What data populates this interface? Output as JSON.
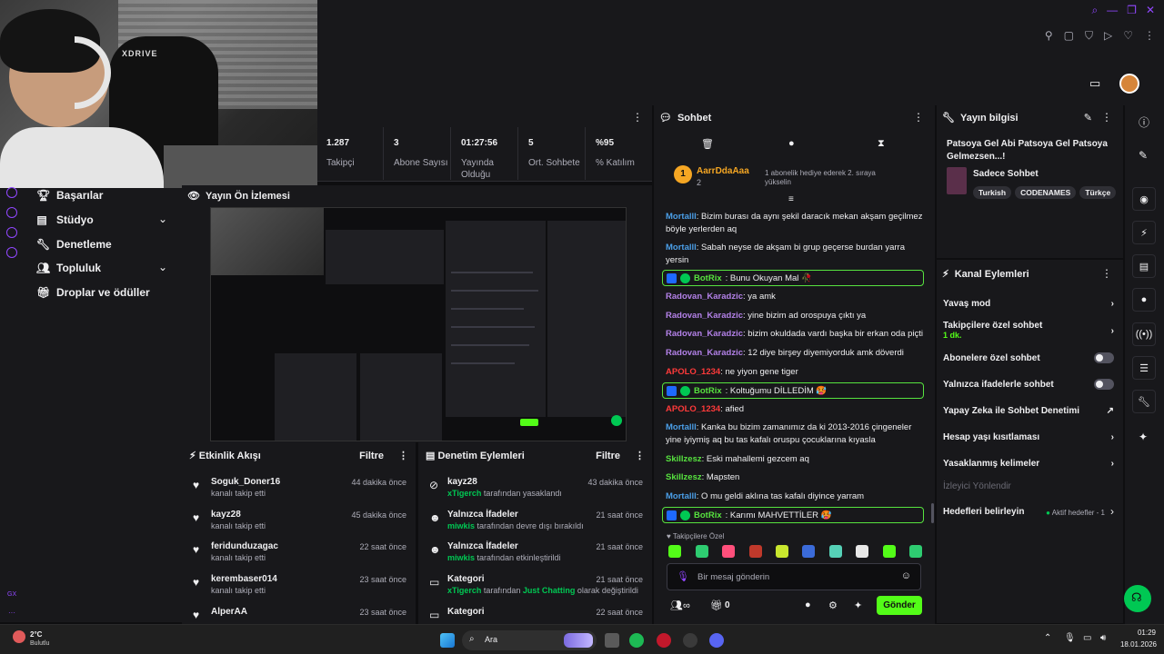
{
  "webcam": {
    "chair_logo": "XDRIVE"
  },
  "stats": [
    {
      "value": "1.287",
      "label": "Takipçi"
    },
    {
      "value": "3",
      "label": "Abone Sayısı"
    },
    {
      "value": "01:27:56",
      "label": "Yayında Olduğu"
    },
    {
      "value": "5",
      "label": "Ort. Sohbete"
    },
    {
      "value": "%95",
      "label": "% Katılım"
    }
  ],
  "nav": {
    "items": [
      {
        "label": "Başarılar",
        "icon": "trophy-icon"
      },
      {
        "label": "Stüdyo",
        "icon": "studio-icon"
      },
      {
        "label": "Denetleme",
        "icon": "wrench-icon"
      },
      {
        "label": "Topluluk",
        "icon": "community-icon"
      },
      {
        "label": "Droplar ve ödüller",
        "icon": "gift-icon"
      }
    ]
  },
  "preview": {
    "title": "Yayın Ön İzlemesi"
  },
  "activity": {
    "title": "Etkinlik Akışı",
    "filter": "Filtre",
    "items": [
      {
        "name": "Soguk_Doner16",
        "sub": "kanalı takip etti",
        "time": "44 dakika önce"
      },
      {
        "name": "kayz28",
        "sub": "kanalı takip etti",
        "time": "45 dakika önce"
      },
      {
        "name": "feridunduzagac",
        "sub": "kanalı takip etti",
        "time": "22 saat önce"
      },
      {
        "name": "kerembaser014",
        "sub": "kanalı takip etti",
        "time": "23 saat önce"
      },
      {
        "name": "AlperAA",
        "sub": "",
        "time": "23 saat önce"
      }
    ]
  },
  "moderation": {
    "title": "Denetim Eylemleri",
    "filter": "Filtre",
    "items": [
      {
        "name": "kayz28",
        "actor": "xTigerch",
        "sub": " tarafından yasaklandı",
        "extra": "",
        "sub2": "",
        "time": "43 dakika önce"
      },
      {
        "name": "Yalnızca İfadeler",
        "actor": "miwkis",
        "sub": " tarafından devre dışı bırakıldı",
        "extra": "",
        "sub2": "",
        "time": "21 saat önce"
      },
      {
        "name": "Yalnızca İfadeler",
        "actor": "miwkis",
        "sub": " tarafından etkinleştirildi",
        "extra": "",
        "sub2": "",
        "time": "21 saat önce"
      },
      {
        "name": "Kategori",
        "actor": "xTigerch",
        "sub": " tarafından ",
        "extra": "Just Chatting",
        "sub2": " olarak değiştirildi",
        "time": "21 saat önce"
      },
      {
        "name": "Kategori",
        "actor": "",
        "sub": "",
        "extra": "",
        "sub2": "",
        "time": "22 saat önce"
      }
    ]
  },
  "chat": {
    "title": "Sohbet",
    "pinned_user": "AarrDdaAaa",
    "pinned_count": "2",
    "pinned_text": "1 abonelik hediye ederek 2. sıraya yükselin",
    "messages": [
      {
        "user": "Mortalll",
        "cls": "u-mortal",
        "text": ": Bizim burası da aynı şekil daracık mekan akşam geçilmez böyle yerlerden aq"
      },
      {
        "user": "Mortalll",
        "cls": "u-mortal",
        "text": ": Sabah neyse de akşam bi grup geçerse burdan yarra yersin"
      },
      {
        "user": "BotRix",
        "cls": "u-bot",
        "text": ": Bunu Okuyan Mal 🥀",
        "bot": true
      },
      {
        "user": "Radovan_Karadzic",
        "cls": "u-radovan",
        "text": ": ya amk"
      },
      {
        "user": "Radovan_Karadzic",
        "cls": "u-radovan",
        "text": ": yine bizim ad orospuya çıktı ya"
      },
      {
        "user": "Radovan_Karadzic",
        "cls": "u-radovan",
        "text": ": bizim okuldada vardı başka bir erkan oda piçti"
      },
      {
        "user": "Radovan_Karadzic",
        "cls": "u-radovan",
        "text": ": 12 diye birşey diyemiyorduk amk döverdi"
      },
      {
        "user": "APOLO_1234",
        "cls": "u-apolo",
        "text": ": ne yiyon gene tiger"
      },
      {
        "user": "BotRix",
        "cls": "u-bot",
        "text": ": Koltuğumu DİLLEDİM 🥵",
        "bot": true
      },
      {
        "user": "APOLO_1234",
        "cls": "u-apolo",
        "text": ": afied"
      },
      {
        "user": "Mortalll",
        "cls": "u-mortal",
        "text": ": Kanka bu bizim zamanımız da ki 2013-2016 çingeneler yine iyiymiş aq bu tas kafalı oruspu çocuklarına kıyasla"
      },
      {
        "user": "Skillzesz",
        "cls": "u-skill",
        "text": ": Eski mahallemi gezcem aq"
      },
      {
        "user": "Skillzesz",
        "cls": "u-skill",
        "text": ": Mapsten"
      },
      {
        "user": "Mortalll",
        "cls": "u-mortal",
        "text": ": O mu geldi aklına tas kafalı diyince yarram"
      },
      {
        "user": "BotRix",
        "cls": "u-bot",
        "text": ": Karımı MAHVETTİLER 🥵",
        "bot": true
      }
    ],
    "followers_only": "Takipçilere Özel",
    "input_placeholder": "Bir mesaj gönderin",
    "points": "0",
    "send": "Gönder"
  },
  "stream_info": {
    "title": "Yayın bilgisi",
    "stream_title": "Patsoya Gel Abi Patsoya Gel Patsoya Gelmezsen...!",
    "category": "Sadece Sohbet",
    "tags": [
      "Turkish",
      "CODENAMES",
      "Türkçe"
    ]
  },
  "channel_actions": {
    "title": "Kanal Eylemleri",
    "rows": [
      {
        "label": "Yavaş mod",
        "type": "chevron"
      },
      {
        "label": "Takipçilere özel sohbet",
        "type": "chevron",
        "sub": "1 dk."
      },
      {
        "label": "Abonelere özel sohbet",
        "type": "toggle"
      },
      {
        "label": "Yalnızca ifadelerle sohbet",
        "type": "toggle"
      },
      {
        "label": "Yapay Zeka ile Sohbet Denetimi",
        "type": "external"
      },
      {
        "label": "Hesap yaşı kısıtlaması",
        "type": "chevron"
      },
      {
        "label": "Yasaklanmış kelimeler",
        "type": "chevron"
      },
      {
        "label": "İzleyici Yönlendir",
        "type": "muted"
      },
      {
        "label": "Hedefleri belirleyin",
        "type": "chevron",
        "right": "Aktif hedefler - 1"
      }
    ]
  },
  "left_rail": {
    "gx": "GX"
  },
  "taskbar": {
    "weather_temp": "2°C",
    "weather_text": "Bulutlu",
    "search": "Ara",
    "time": "01:29",
    "date": "18.01.2026"
  },
  "colors": {
    "accent": "#9147ff",
    "green": "#00c853",
    "kick_green": "#53fc18"
  }
}
